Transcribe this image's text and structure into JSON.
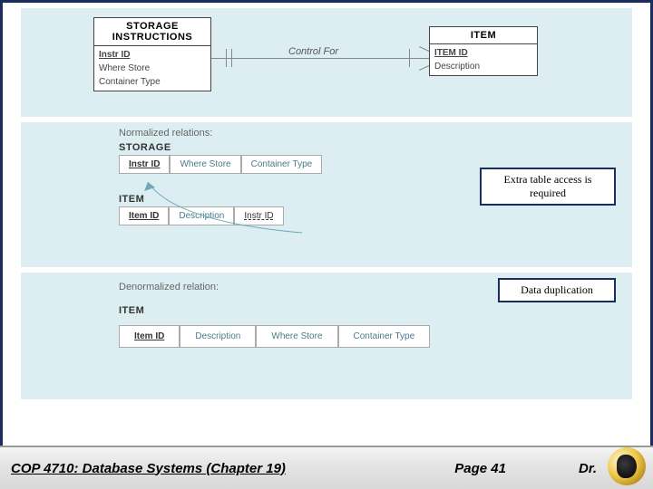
{
  "erd": {
    "storage": {
      "title": "STORAGE INSTRUCTIONS",
      "pk": "Instr ID",
      "attr1": "Where Store",
      "attr2": "Container Type"
    },
    "item": {
      "title": "ITEM",
      "pk": "ITEM ID",
      "attr1": "Description"
    },
    "relationship": "Control For"
  },
  "normalized": {
    "heading": "Normalized relations:",
    "storage_label": "STORAGE",
    "storage_cols": {
      "c0": "Instr ID",
      "c1": "Where Store",
      "c2": "Container Type"
    },
    "item_label": "ITEM",
    "item_cols": {
      "c0": "Item ID",
      "c1": "Description",
      "c2": "Instr ID"
    },
    "callout": "Extra table access is required"
  },
  "denormalized": {
    "heading": "Denormalized relation:",
    "item_label": "ITEM",
    "cols": {
      "c0": "Item ID",
      "c1": "Description",
      "c2": "Where Store",
      "c3": "Container Type"
    },
    "callout": "Data duplication"
  },
  "footer": {
    "left": "COP 4710: Database Systems  (Chapter 19)",
    "mid": "Page 41",
    "right": "Dr."
  }
}
